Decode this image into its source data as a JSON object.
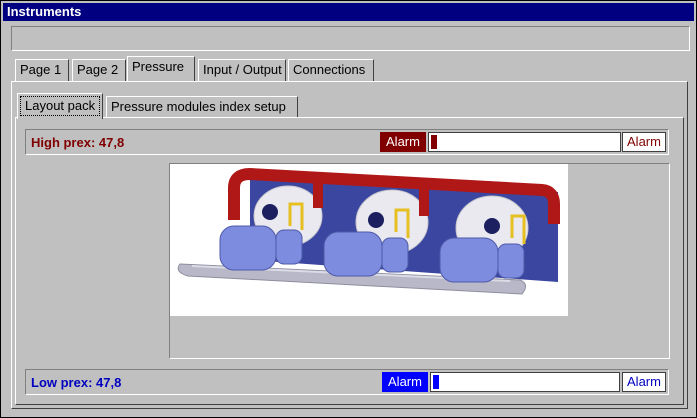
{
  "window": {
    "title": "Instruments"
  },
  "tabs": [
    {
      "label": "Page 1"
    },
    {
      "label": "Page 2"
    },
    {
      "label": "Pressure"
    },
    {
      "label": "Input / Output"
    },
    {
      "label": "Connections"
    }
  ],
  "subtabs": [
    {
      "label": "Layout pack"
    },
    {
      "label": "Pressure modules index setup"
    }
  ],
  "high": {
    "label": "High prex: 47,8",
    "alarm_led": "Alarm",
    "alarm_button": "Alarm",
    "level": 0.03,
    "label_color": "#800000",
    "led_color": "#800000",
    "fill_color": "#800000"
  },
  "low": {
    "label": "Low prex: 47,8",
    "alarm_led": "Alarm",
    "alarm_button": "Alarm",
    "level": 0.03,
    "label_color": "#0000c0",
    "led_color": "#0000ff",
    "fill_color": "#0000ff"
  },
  "picture": {
    "icon": "compressor-rack-image"
  }
}
